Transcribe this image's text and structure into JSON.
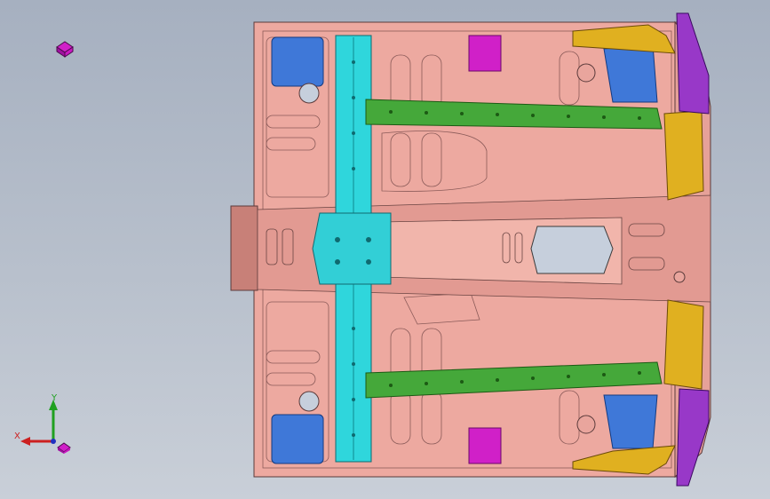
{
  "viewport": {
    "background_top": "#a6b0c0",
    "background_bottom": "#c9cfd8"
  },
  "triad": {
    "x_label": "X",
    "y_label": "Y",
    "x_color": "#cc2020",
    "y_color": "#20a020",
    "z_color": "#2030c0"
  },
  "icons": {
    "view_cube": "view-cube-icon",
    "triad_cube": "triad-cube-icon"
  },
  "model_colors": {
    "floor_panel": "#eda9a0",
    "cross_member": "#2fd6dc",
    "rails": "#45a83a",
    "brackets": "#3f78d8",
    "pads": "#d020c8",
    "reinforcements": "#e0b020",
    "sill": "#9838c8",
    "hole": "#c6cfdc"
  }
}
